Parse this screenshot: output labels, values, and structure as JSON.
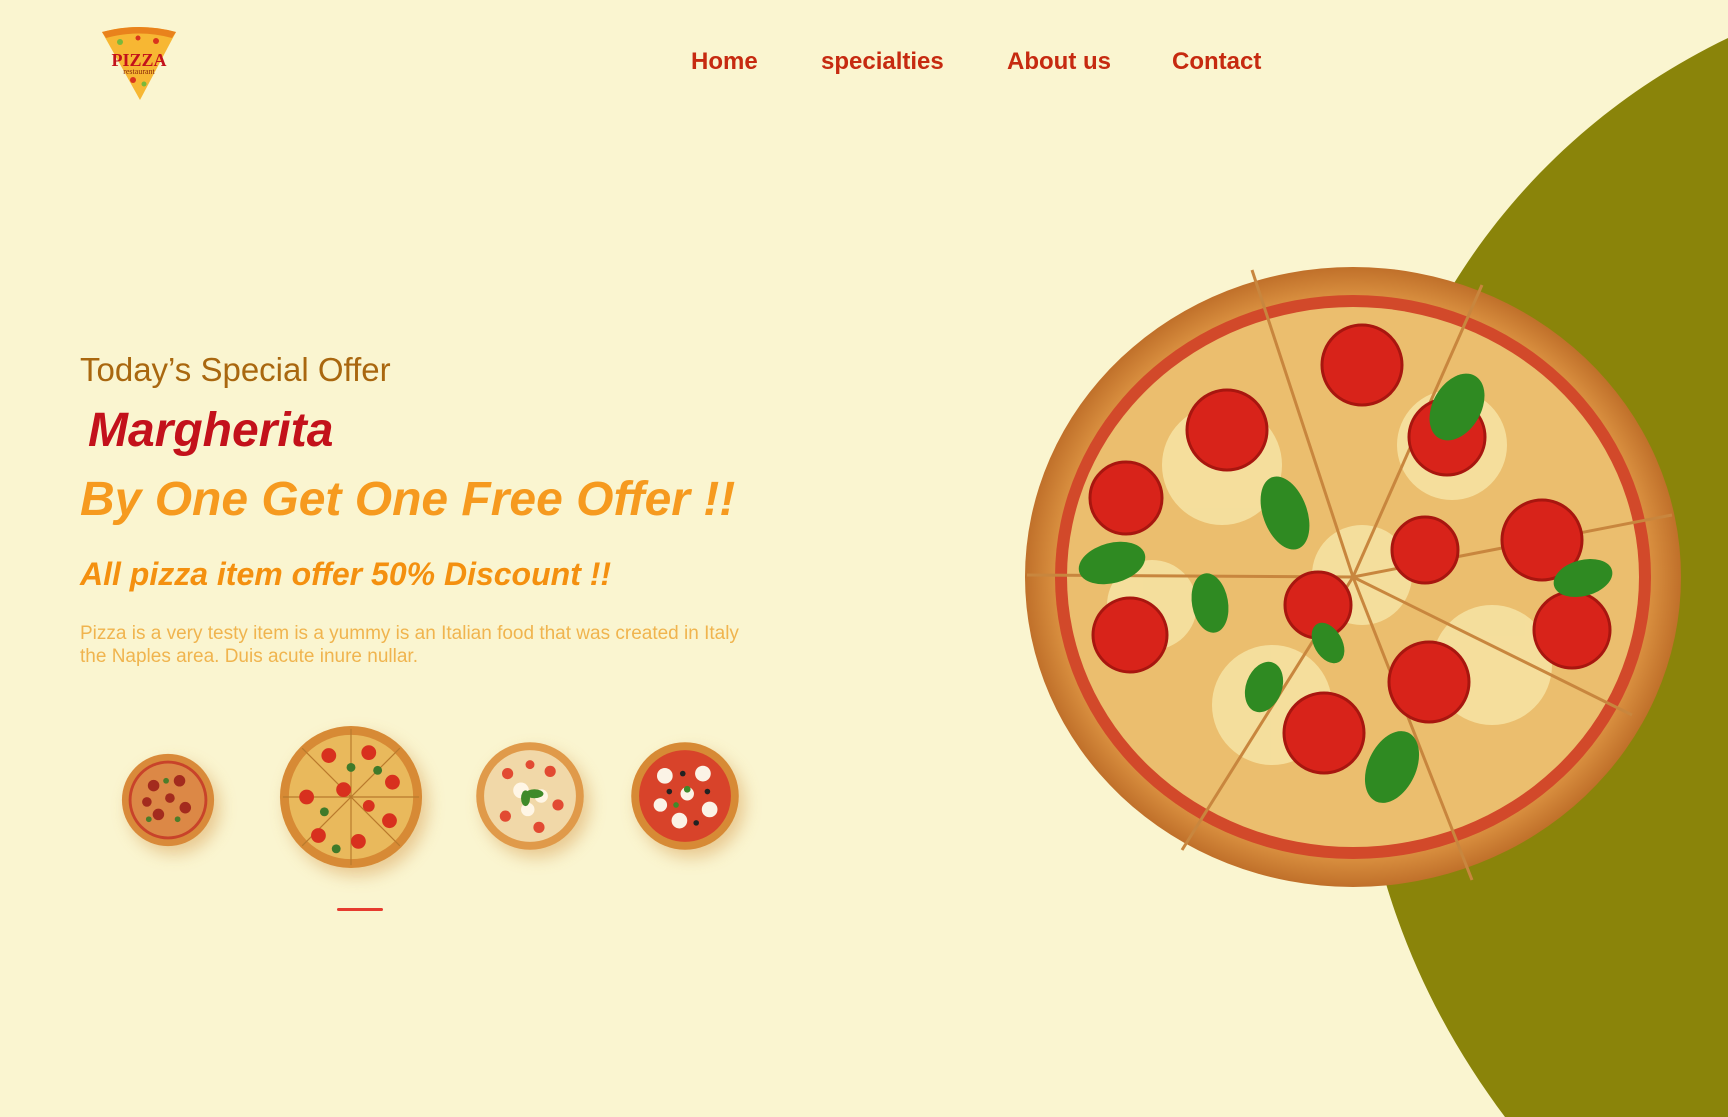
{
  "colors": {
    "background": "#faf5d0",
    "olive_accent": "#8a840a",
    "nav_red": "#c62a10",
    "eyebrow_brown": "#a9670f",
    "dish_red": "#c3111b",
    "offer_orange": "#f69a1f",
    "desc_orange": "#f0b44e",
    "indicator_red": "#e63b2e"
  },
  "logo": {
    "word": "PIZZA",
    "sub": "restaurant",
    "icon": "pizza-slice-logo"
  },
  "nav": [
    {
      "label": "Home"
    },
    {
      "label": "specialties"
    },
    {
      "label": "About us"
    },
    {
      "label": "Contact"
    }
  ],
  "hero": {
    "eyebrow": "Today’s Special Offer",
    "dish": "Margherita",
    "offer": "By One Get One Free Offer !!",
    "discount": "All pizza item offer 50% Discount !!",
    "description": "Pizza is a very testy item is a yummy is an Italian food that was created in Italy  the Naples area. Duis acute inure nullar."
  },
  "carousel": {
    "active_index": 1,
    "items": [
      {
        "icon": "pizza-thumbnail-icon"
      },
      {
        "icon": "pizza-thumbnail-icon"
      },
      {
        "icon": "pizza-thumbnail-icon"
      },
      {
        "icon": "pizza-thumbnail-icon"
      }
    ]
  },
  "hero_image": {
    "icon": "margherita-pizza-image"
  }
}
